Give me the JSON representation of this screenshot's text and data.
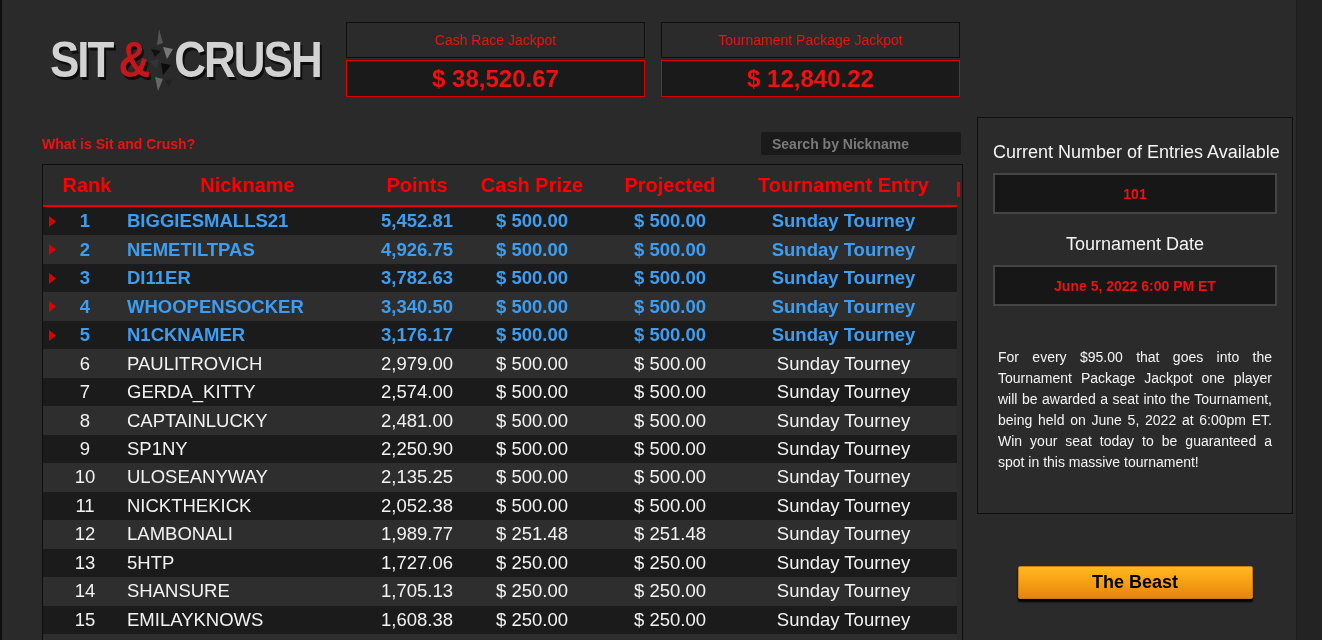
{
  "logo": {
    "left": "SIT",
    "mark": "&",
    "right": "CRUSH"
  },
  "jackpots": [
    {
      "label": "Cash Race Jackpot",
      "amount": "$ 38,520.67"
    },
    {
      "label": "Tournament Package Jackpot",
      "amount": "$ 12,840.22"
    }
  ],
  "info_link": "What is Sit and Crush?",
  "search": {
    "placeholder": "Search by Nickname"
  },
  "table": {
    "columns": [
      "Rank",
      "Nickname",
      "Points",
      "Cash Prize",
      "Projected",
      "Tournament Entry"
    ],
    "rows": [
      {
        "qualified": true,
        "cells": [
          "1",
          "BIGGIESMALLS21",
          "5,452.81",
          "$ 500.00",
          "$ 500.00",
          "Sunday Tourney"
        ]
      },
      {
        "qualified": true,
        "cells": [
          "2",
          "NEMETILTPAS",
          "4,926.75",
          "$ 500.00",
          "$ 500.00",
          "Sunday Tourney"
        ]
      },
      {
        "qualified": true,
        "cells": [
          "3",
          "DI11ER",
          "3,782.63",
          "$ 500.00",
          "$ 500.00",
          "Sunday Tourney"
        ]
      },
      {
        "qualified": true,
        "cells": [
          "4",
          "WHOOPENSOCKER",
          "3,340.50",
          "$ 500.00",
          "$ 500.00",
          "Sunday Tourney"
        ]
      },
      {
        "qualified": true,
        "cells": [
          "5",
          "N1CKNAMER",
          "3,176.17",
          "$ 500.00",
          "$ 500.00",
          "Sunday Tourney"
        ]
      },
      {
        "qualified": false,
        "cells": [
          "6",
          "PAULITROVICH",
          "2,979.00",
          "$ 500.00",
          "$ 500.00",
          "Sunday Tourney"
        ]
      },
      {
        "qualified": false,
        "cells": [
          "7",
          "GERDA_KITTY",
          "2,574.00",
          "$ 500.00",
          "$ 500.00",
          "Sunday Tourney"
        ]
      },
      {
        "qualified": false,
        "cells": [
          "8",
          "CAPTAINLUCKY",
          "2,481.00",
          "$ 500.00",
          "$ 500.00",
          "Sunday Tourney"
        ]
      },
      {
        "qualified": false,
        "cells": [
          "9",
          "SP1NY",
          "2,250.90",
          "$ 500.00",
          "$ 500.00",
          "Sunday Tourney"
        ]
      },
      {
        "qualified": false,
        "cells": [
          "10",
          "ULOSEANYWAY",
          "2,135.25",
          "$ 500.00",
          "$ 500.00",
          "Sunday Tourney"
        ]
      },
      {
        "qualified": false,
        "cells": [
          "11",
          "NICKTHEKICK",
          "2,052.38",
          "$ 500.00",
          "$ 500.00",
          "Sunday Tourney"
        ]
      },
      {
        "qualified": false,
        "cells": [
          "12",
          "LAMBONALI",
          "1,989.77",
          "$ 251.48",
          "$ 251.48",
          "Sunday Tourney"
        ]
      },
      {
        "qualified": false,
        "cells": [
          "13",
          "5HTP",
          "1,727.06",
          "$ 250.00",
          "$ 250.00",
          "Sunday Tourney"
        ]
      },
      {
        "qualified": false,
        "cells": [
          "14",
          "SHANSURE",
          "1,705.13",
          "$ 250.00",
          "$ 250.00",
          "Sunday Tourney"
        ]
      },
      {
        "qualified": false,
        "cells": [
          "15",
          "EMILAYKNOWS",
          "1,608.38",
          "$ 250.00",
          "$ 250.00",
          "Sunday Tourney"
        ]
      }
    ]
  },
  "sidebar": {
    "entries_label": "Current Number of Entries Available",
    "entries_value": "101",
    "date_label": "Tournament Date",
    "date_value": "June 5, 2022 6:00 PM ET",
    "description": "For every $95.00 that goes into the Tournament Package Jackpot one player will be awarded a seat into the Tournament, being held on June 5, 2022 at 6:00pm ET. Win your seat today to be guaranteed a spot in this massive tournament!"
  },
  "button": "The Beast"
}
